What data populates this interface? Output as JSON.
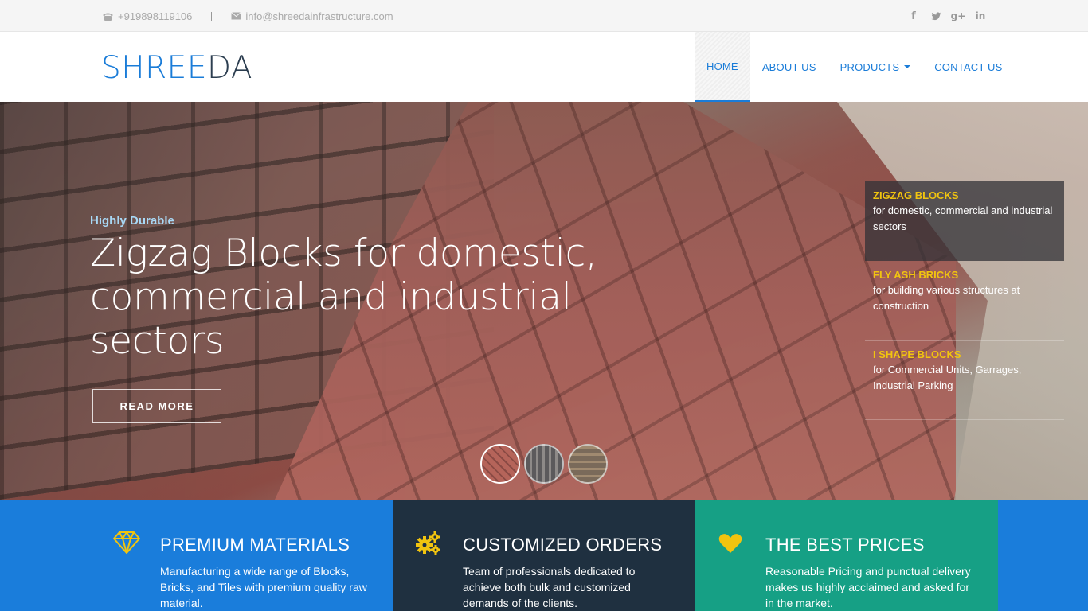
{
  "topbar": {
    "phone": "+919898119106",
    "email": "info@shreedainfrastructure.com",
    "social": [
      "facebook-icon",
      "twitter-icon",
      "google-plus-icon",
      "linkedin-icon"
    ]
  },
  "header": {
    "logo_part1": "SHREE",
    "logo_part2": "DA",
    "nav": [
      {
        "label": "HOME",
        "active": true
      },
      {
        "label": "ABOUT US"
      },
      {
        "label": "PRODUCTS",
        "dropdown": true
      },
      {
        "label": "CONTACT US"
      }
    ]
  },
  "hero": {
    "subtitle": "Highly Durable",
    "title": "Zigzag Blocks for domestic, commercial and industrial sectors",
    "cta": "READ MORE",
    "slides": [
      {
        "title": "ZIGZAG BLOCKS",
        "desc": "for domestic, commercial and industrial sectors"
      },
      {
        "title": "FLY ASH BRICKS",
        "desc": "for building various structures at construction"
      },
      {
        "title": "I SHAPE BLOCKS",
        "desc": "for Commercial Units, Garrages, Industrial Parking"
      }
    ]
  },
  "features": [
    {
      "title": "PREMIUM MATERIALS",
      "desc": "Manufacturing a wide range of Blocks, Bricks, and Tiles with premium quality raw material.",
      "icon": "diamond-icon"
    },
    {
      "title": "CUSTOMIZED ORDERS",
      "desc": "Team of professionals dedicated to achieve both bulk and customized demands of the clients.",
      "icon": "gears-icon"
    },
    {
      "title": "THE BEST PRICES",
      "desc": "Reasonable Pricing and punctual delivery makes us highly acclaimed and asked for in the market.",
      "icon": "heart-icon"
    }
  ],
  "colors": {
    "accent": "#1a7cd8",
    "highlight": "#f1c40f",
    "dark": "#1f3040",
    "teal": "#16a085"
  }
}
